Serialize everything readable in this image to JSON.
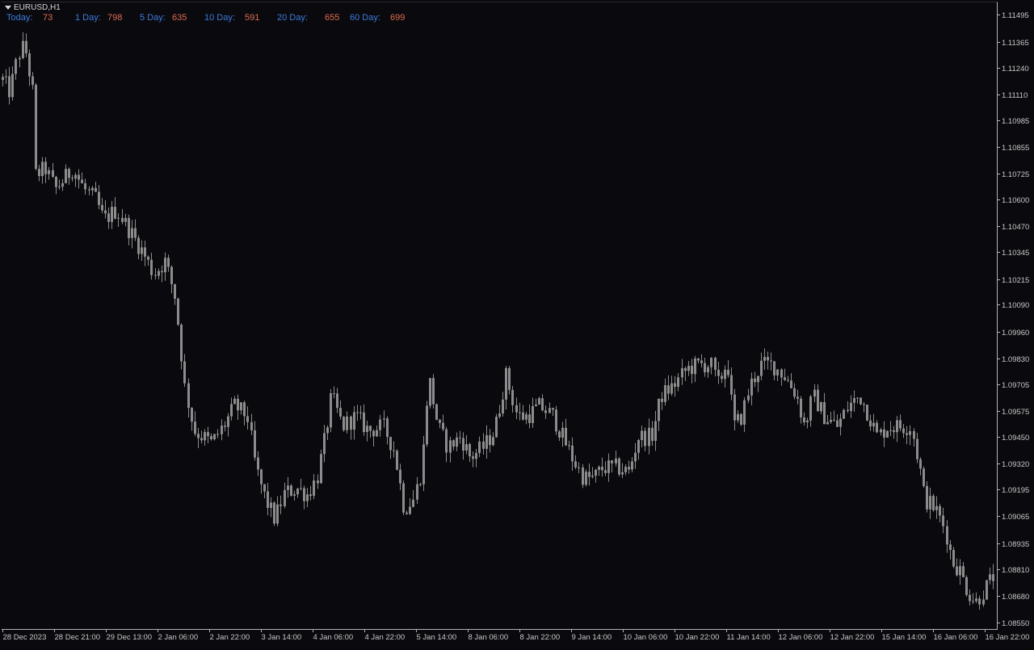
{
  "header": {
    "symbol": "EURUSD,H1",
    "stats": [
      {
        "label": "Today:",
        "value": "73"
      },
      {
        "label": "1 Day:",
        "value": "798"
      },
      {
        "label": "5 Day:",
        "value": "635"
      },
      {
        "label": "10 Day:",
        "value": "591"
      },
      {
        "label": "20 Day:",
        "value": "655"
      },
      {
        "label": "60 Day:",
        "value": "699"
      }
    ]
  },
  "colors": {
    "background": "#0a0a0e",
    "candle": "#8c8c8c",
    "axis": "#b4b4b4",
    "label_blue": "#3d7bdb",
    "value_red": "#e06b4d"
  },
  "chart_data": {
    "type": "candlestick",
    "title": "",
    "xlabel": "",
    "ylabel": "",
    "ylim": [
      1.08519,
      1.11559
    ],
    "grid": false,
    "y_ticks": [
      "1.11495",
      "1.11365",
      "1.11240",
      "1.11110",
      "1.10985",
      "1.10855",
      "1.10725",
      "1.10600",
      "1.10470",
      "1.10345",
      "1.10215",
      "1.10090",
      "1.09960",
      "1.09830",
      "1.09705",
      "1.09575",
      "1.09450",
      "1.09320",
      "1.09195",
      "1.09065",
      "1.08935",
      "1.08810",
      "1.08680",
      "1.08550"
    ],
    "x_ticks": [
      "28 Dec 2023",
      "28 Dec 21:00",
      "29 Dec 13:00",
      "2 Jan 06:00",
      "2 Jan 22:00",
      "3 Jan 14:00",
      "4 Jan 06:00",
      "4 Jan 22:00",
      "5 Jan 14:00",
      "8 Jan 06:00",
      "8 Jan 22:00",
      "9 Jan 14:00",
      "10 Jan 06:00",
      "10 Jan 22:00",
      "11 Jan 14:00",
      "12 Jan 06:00",
      "12 Jan 22:00",
      "15 Jan 14:00",
      "16 Jan 06:00",
      "16 Jan 22:00"
    ],
    "close_trajectory": [
      [
        0,
        1.112
      ],
      [
        12,
        1.1112
      ],
      [
        22,
        1.113
      ],
      [
        30,
        1.1135
      ],
      [
        40,
        1.1112
      ],
      [
        44,
        1.1072
      ],
      [
        56,
        1.1075
      ],
      [
        68,
        1.1065
      ],
      [
        90,
        1.1075
      ],
      [
        104,
        1.1065
      ],
      [
        118,
        1.106
      ],
      [
        128,
        1.105
      ],
      [
        144,
        1.1055
      ],
      [
        160,
        1.1045
      ],
      [
        176,
        1.1035
      ],
      [
        190,
        1.1024
      ],
      [
        204,
        1.103
      ],
      [
        216,
        1.1014
      ],
      [
        222,
        1.0995
      ],
      [
        228,
        1.097
      ],
      [
        240,
        1.0948
      ],
      [
        262,
        1.0942
      ],
      [
        276,
        1.095
      ],
      [
        290,
        1.096
      ],
      [
        306,
        1.0955
      ],
      [
        316,
        1.093
      ],
      [
        328,
        1.0915
      ],
      [
        340,
        1.0905
      ],
      [
        352,
        1.0918
      ],
      [
        368,
        1.092
      ],
      [
        380,
        1.0917
      ],
      [
        392,
        1.0925
      ],
      [
        402,
        1.0945
      ],
      [
        410,
        1.0965
      ],
      [
        424,
        1.095
      ],
      [
        440,
        1.0955
      ],
      [
        456,
        1.0948
      ],
      [
        474,
        1.095
      ],
      [
        488,
        1.0938
      ],
      [
        500,
        1.091
      ],
      [
        512,
        1.0915
      ],
      [
        522,
        1.093
      ],
      [
        530,
        1.0975
      ],
      [
        542,
        1.095
      ],
      [
        554,
        1.094
      ],
      [
        570,
        1.0945
      ],
      [
        582,
        1.0935
      ],
      [
        598,
        1.094
      ],
      [
        612,
        1.0948
      ],
      [
        626,
        1.0975
      ],
      [
        640,
        1.0955
      ],
      [
        652,
        1.0955
      ],
      [
        668,
        1.096
      ],
      [
        684,
        1.0955
      ],
      [
        696,
        1.0945
      ],
      [
        708,
        1.0935
      ],
      [
        722,
        1.0925
      ],
      [
        734,
        1.0925
      ],
      [
        746,
        1.093
      ],
      [
        764,
        1.093
      ],
      [
        778,
        1.0928
      ],
      [
        790,
        1.0945
      ],
      [
        806,
        1.0945
      ],
      [
        818,
        1.0965
      ],
      [
        834,
        1.097
      ],
      [
        850,
        1.0978
      ],
      [
        866,
        1.098
      ],
      [
        880,
        1.098
      ],
      [
        888,
        1.097
      ],
      [
        900,
        1.0982
      ],
      [
        908,
        1.095
      ],
      [
        918,
        1.0955
      ],
      [
        928,
        1.097
      ],
      [
        942,
        1.098
      ],
      [
        956,
        1.098
      ],
      [
        970,
        1.0975
      ],
      [
        986,
        1.0965
      ],
      [
        996,
        1.095
      ],
      [
        1006,
        1.0965
      ],
      [
        1020,
        1.0955
      ],
      [
        1036,
        1.095
      ],
      [
        1050,
        1.096
      ],
      [
        1064,
        1.0965
      ],
      [
        1076,
        1.0955
      ],
      [
        1086,
        1.0945
      ],
      [
        1098,
        1.095
      ],
      [
        1112,
        1.095
      ],
      [
        1128,
        1.095
      ],
      [
        1138,
        1.093
      ],
      [
        1144,
        1.0915
      ],
      [
        1158,
        1.091
      ],
      [
        1170,
        1.09
      ],
      [
        1178,
        1.0885
      ],
      [
        1188,
        1.088
      ],
      [
        1198,
        1.087
      ],
      [
        1208,
        1.0865
      ],
      [
        1220,
        1.0872
      ],
      [
        1230,
        1.0878
      ]
    ]
  }
}
